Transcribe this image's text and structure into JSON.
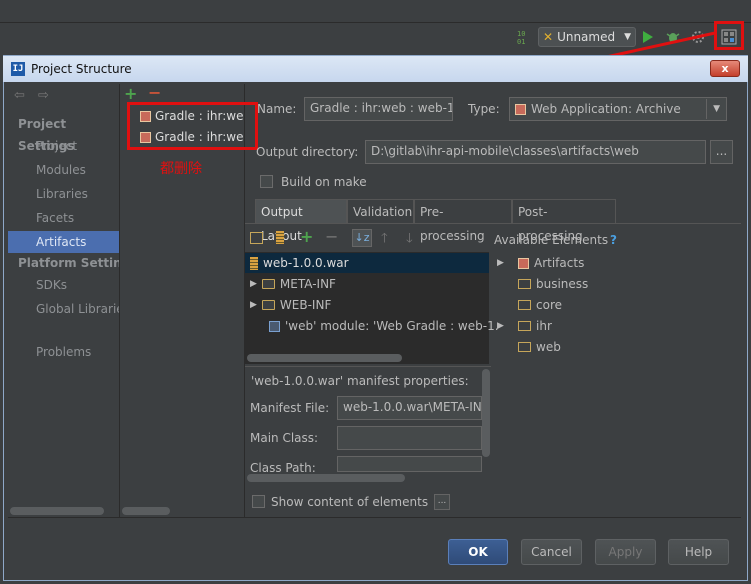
{
  "ide": {
    "run_config": "Unnamed"
  },
  "dialog": {
    "title": "Project Structure",
    "close": "x"
  },
  "nav": {
    "project_settings": "Project Settings",
    "project": "Project",
    "modules": "Modules",
    "libraries": "Libraries",
    "facets": "Facets",
    "artifacts": "Artifacts",
    "platform_settings": "Platform Setting",
    "sdks": "SDKs",
    "global_libraries": "Global Librarie",
    "problems": "Problems"
  },
  "artifacts": {
    "add": "+",
    "remove": "−",
    "items": [
      "Gradle : ihr:we",
      "Gradle : ihr:we"
    ],
    "annotation": "都删除"
  },
  "form": {
    "name_label": "Name:",
    "name_value": "Gradle : ihr:web : web-1",
    "type_label": "Type:",
    "type_value": "Web Application: Archive",
    "output_dir_label": "Output directory:",
    "output_dir_value": "D:\\gitlab\\ihr-api-mobile\\classes\\artifacts\\web",
    "browse": "...",
    "build_on_make": "Build on make"
  },
  "tabs": [
    "Output Layout",
    "Validation",
    "Pre-processing",
    "Post-processing"
  ],
  "layout": {
    "available_elements": "Available Elements",
    "help_mark": "?",
    "tree": {
      "root": "web-1.0.0.war",
      "meta_inf": "META-INF",
      "web_inf": "WEB-INF",
      "module": "'web' module: 'Web Gradle : web-1."
    },
    "available": {
      "artifacts": "Artifacts",
      "business": "business",
      "core": "core",
      "ihr": "ihr",
      "web": "web"
    }
  },
  "manifest": {
    "title": "'web-1.0.0.war' manifest properties:",
    "file_label": "Manifest File:",
    "file_value": "web-1.0.0.war\\META-IN",
    "main_class_label": "Main Class:",
    "class_path_label": "Class Path:"
  },
  "show_content": "Show content of elements",
  "show_content_btn": "...",
  "buttons": {
    "ok": "OK",
    "cancel": "Cancel",
    "apply": "Apply",
    "help": "Help"
  },
  "colors": {
    "annotation_red": "#e01010",
    "selection_blue": "#4b6eaf",
    "background": "#3c3f41"
  }
}
